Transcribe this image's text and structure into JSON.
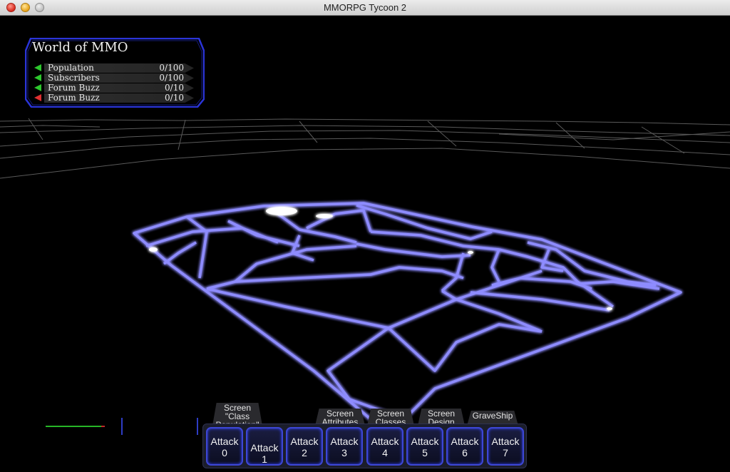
{
  "window": {
    "title": "MMORPG Tycoon 2"
  },
  "stats_panel": {
    "title": "World of MMO",
    "rows": [
      {
        "label": "Population",
        "value": "0/100",
        "trend": "up"
      },
      {
        "label": "Subscribers",
        "value": "0/100",
        "trend": "up"
      },
      {
        "label": "Forum Buzz",
        "value": "0/10",
        "trend": "up"
      },
      {
        "label": "Forum Buzz",
        "value": "0/10",
        "trend": "down"
      }
    ]
  },
  "tabs": [
    {
      "label": "Screen \"Class Population\""
    },
    {
      "label": "Screen Attributes"
    },
    {
      "label": "Screen Classes"
    },
    {
      "label": "Screen Design"
    },
    {
      "label": "GraveShip"
    }
  ],
  "attack_buttons": [
    {
      "label": "Attack 0"
    },
    {
      "label": "Attack 1"
    },
    {
      "label": "Attack 2"
    },
    {
      "label": "Attack 3"
    },
    {
      "label": "Attack 4"
    },
    {
      "label": "Attack 5"
    },
    {
      "label": "Attack 6"
    },
    {
      "label": "Attack 7"
    }
  ],
  "colors": {
    "panel_border": "#2a34d8",
    "map_glow": "#8e8cff",
    "trend_up": "#2dc72d",
    "trend_down": "#e03030"
  }
}
